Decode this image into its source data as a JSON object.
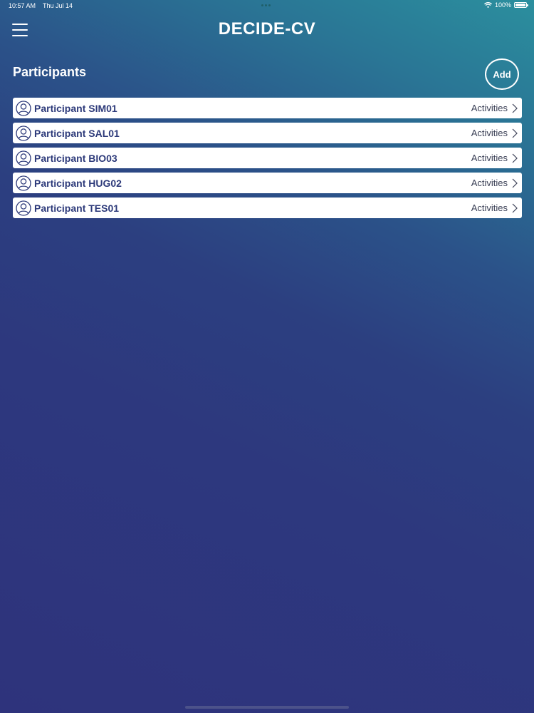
{
  "status_bar": {
    "time": "10:57 AM",
    "date": "Thu Jul 14",
    "battery": "100%"
  },
  "header": {
    "title": "DECIDE-CV"
  },
  "main": {
    "section_title": "Participants",
    "add_label": "Add",
    "participants": [
      {
        "name": "Participant SIM01",
        "action_label": "Activities"
      },
      {
        "name": "Participant SAL01",
        "action_label": "Activities"
      },
      {
        "name": "Participant BIO03",
        "action_label": "Activities"
      },
      {
        "name": "Participant HUG02",
        "action_label": "Activities"
      },
      {
        "name": "Participant TES01",
        "action_label": "Activities"
      }
    ]
  },
  "icons": {
    "menu": "hamburger-menu-icon",
    "avatar": "user-avatar-icon",
    "chevron": "chevron-right-icon",
    "wifi": "wifi-icon",
    "battery": "battery-icon"
  },
  "colors": {
    "row_text": "#2d3a7a",
    "background_top": "#2b8f9e",
    "background_bottom": "#2e337c"
  }
}
